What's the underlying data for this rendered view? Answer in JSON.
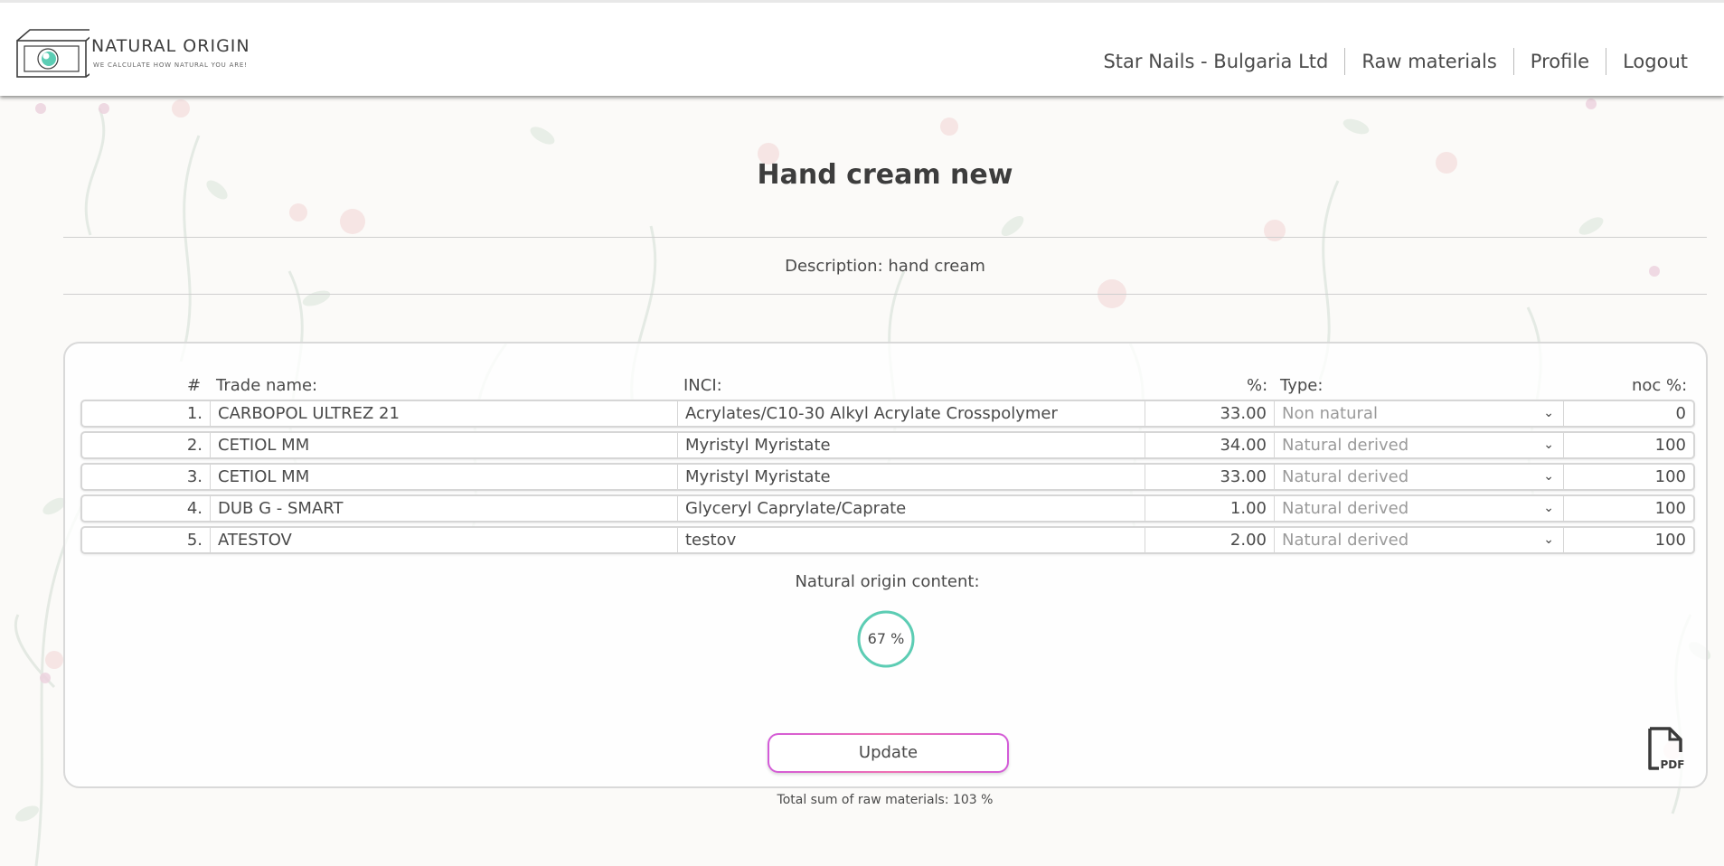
{
  "header": {
    "brand_name": "NATURAL ORIGIN",
    "brand_tagline": "WE CALCULATE HOW NATURAL YOU ARE!",
    "nav": [
      "Star Nails - Bulgaria Ltd",
      "Raw materials",
      "Profile",
      "Logout"
    ]
  },
  "page": {
    "title": "Hand cream new",
    "description": "Description: hand cream"
  },
  "table": {
    "columns": {
      "num": "#",
      "trade": "Trade name:",
      "inci": "INCI:",
      "pct": "%:",
      "type": "Type:",
      "noc": "noc %:"
    },
    "rows": [
      {
        "num": "1.",
        "trade": "CARBOPOL ULTREZ 21",
        "inci": "Acrylates/C10-30 Alkyl Acrylate Crosspolymer",
        "pct": "33.00",
        "type": "Non natural",
        "noc": "0"
      },
      {
        "num": "2.",
        "trade": "CETIOL MM",
        "inci": "Myristyl Myristate",
        "pct": "34.00",
        "type": "Natural derived",
        "noc": "100"
      },
      {
        "num": "3.",
        "trade": "CETIOL MM",
        "inci": "Myristyl Myristate",
        "pct": "33.00",
        "type": "Natural derived",
        "noc": "100"
      },
      {
        "num": "4.",
        "trade": "DUB G - SMART",
        "inci": "Glyceryl Caprylate/Caprate",
        "pct": "1.00",
        "type": "Natural derived",
        "noc": "100"
      },
      {
        "num": "5.",
        "trade": "ATESTOV",
        "inci": "testov",
        "pct": "2.00",
        "type": "Natural derived",
        "noc": "100"
      }
    ]
  },
  "result": {
    "label": "Natural origin content:",
    "value_text": "67 %",
    "value": 67
  },
  "actions": {
    "update_label": "Update",
    "pdf_icon": "pdf-file-icon"
  },
  "footer": {
    "total_text": "Total sum of raw materials: 103 %"
  },
  "colors": {
    "accent_teal": "#5ccdb4",
    "button_border": "#d35bd8",
    "text": "#4a4a4a"
  }
}
